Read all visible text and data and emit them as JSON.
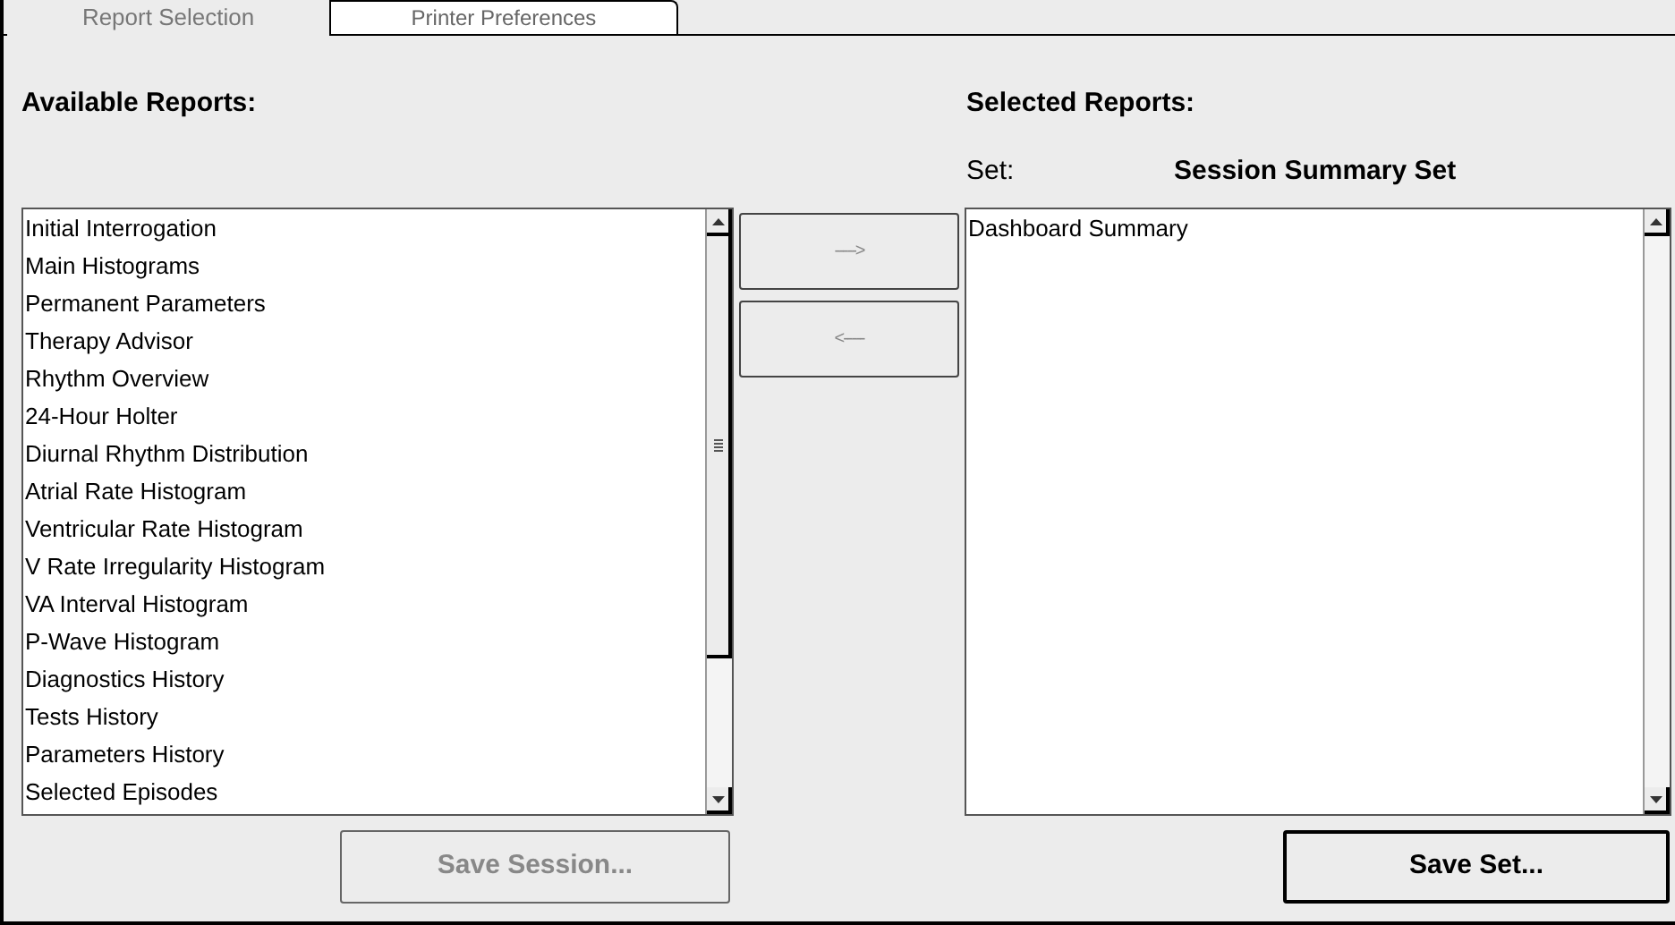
{
  "tabs": [
    {
      "label": "Report Selection",
      "selected": true
    },
    {
      "label": "Printer Preferences",
      "selected": false
    }
  ],
  "available": {
    "title": "Available Reports:",
    "items": [
      "Initial Interrogation",
      "Main Histograms",
      "Permanent Parameters",
      "Therapy Advisor",
      "Rhythm Overview",
      "24-Hour Holter",
      "Diurnal Rhythm Distribution",
      "Atrial Rate Histogram",
      "Ventricular Rate Histogram",
      "V Rate Irregularity Histogram",
      "VA Interval Histogram",
      "P-Wave Histogram",
      "Diagnostics History",
      "Tests History",
      "Parameters History",
      "Selected Episodes"
    ]
  },
  "move_buttons": [
    {
      "label": "----->",
      "disabled": true
    },
    {
      "label": "<-----",
      "disabled": true
    }
  ],
  "selected": {
    "title": "Selected Reports:",
    "set_label": "Set:",
    "set_name": "Session Summary Set",
    "items": [
      "Dashboard Summary"
    ]
  },
  "buttons": [
    {
      "label": "Save Session...",
      "disabled": true
    },
    {
      "label": "Save Set...",
      "disabled": false
    }
  ]
}
